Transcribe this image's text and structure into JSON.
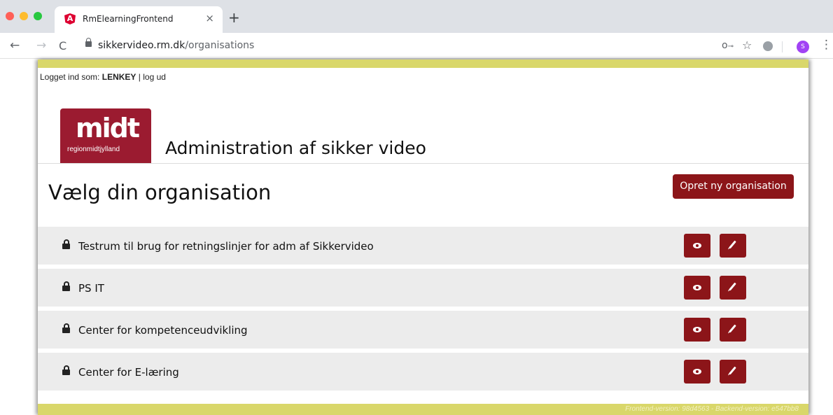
{
  "browser": {
    "tab_title": "RmElearningFrontend",
    "tab_close": "×",
    "new_tab": "+",
    "url_host": "sikkervideo.rm.dk",
    "url_path": "/organisations",
    "profile_initial": "S",
    "icons": [
      "back-arrow-icon",
      "forward-arrow-icon",
      "reload-icon",
      "lock-icon",
      "key-icon",
      "star-icon",
      "extension-icon",
      "profile-avatar",
      "menu-icon"
    ]
  },
  "header": {
    "login_prefix": "Logget ind som:",
    "username": "LENKEY",
    "separator": "|",
    "logout": "log ud",
    "logo_main": "midt",
    "logo_sub": "regionmidtjylland",
    "app_title": "Administration af sikker video"
  },
  "main": {
    "page_title": "Vælg din organisation",
    "create_button": "Opret ny organisation",
    "organisations": [
      {
        "name": "Testrum til brug for retningslinjer for adm af Sikkervideo"
      },
      {
        "name": "PS IT"
      },
      {
        "name": "Center for kompetenceudvikling"
      },
      {
        "name": "Center for E-læring"
      }
    ]
  },
  "footer": {
    "version": "Frontend-version: 98d4563 - Backend-version: e547bb8"
  },
  "colors": {
    "brand_red": "#8c1519",
    "logo_red": "#9b1b30",
    "band_yellow": "#d9d76a",
    "row_gray": "#ececec"
  }
}
